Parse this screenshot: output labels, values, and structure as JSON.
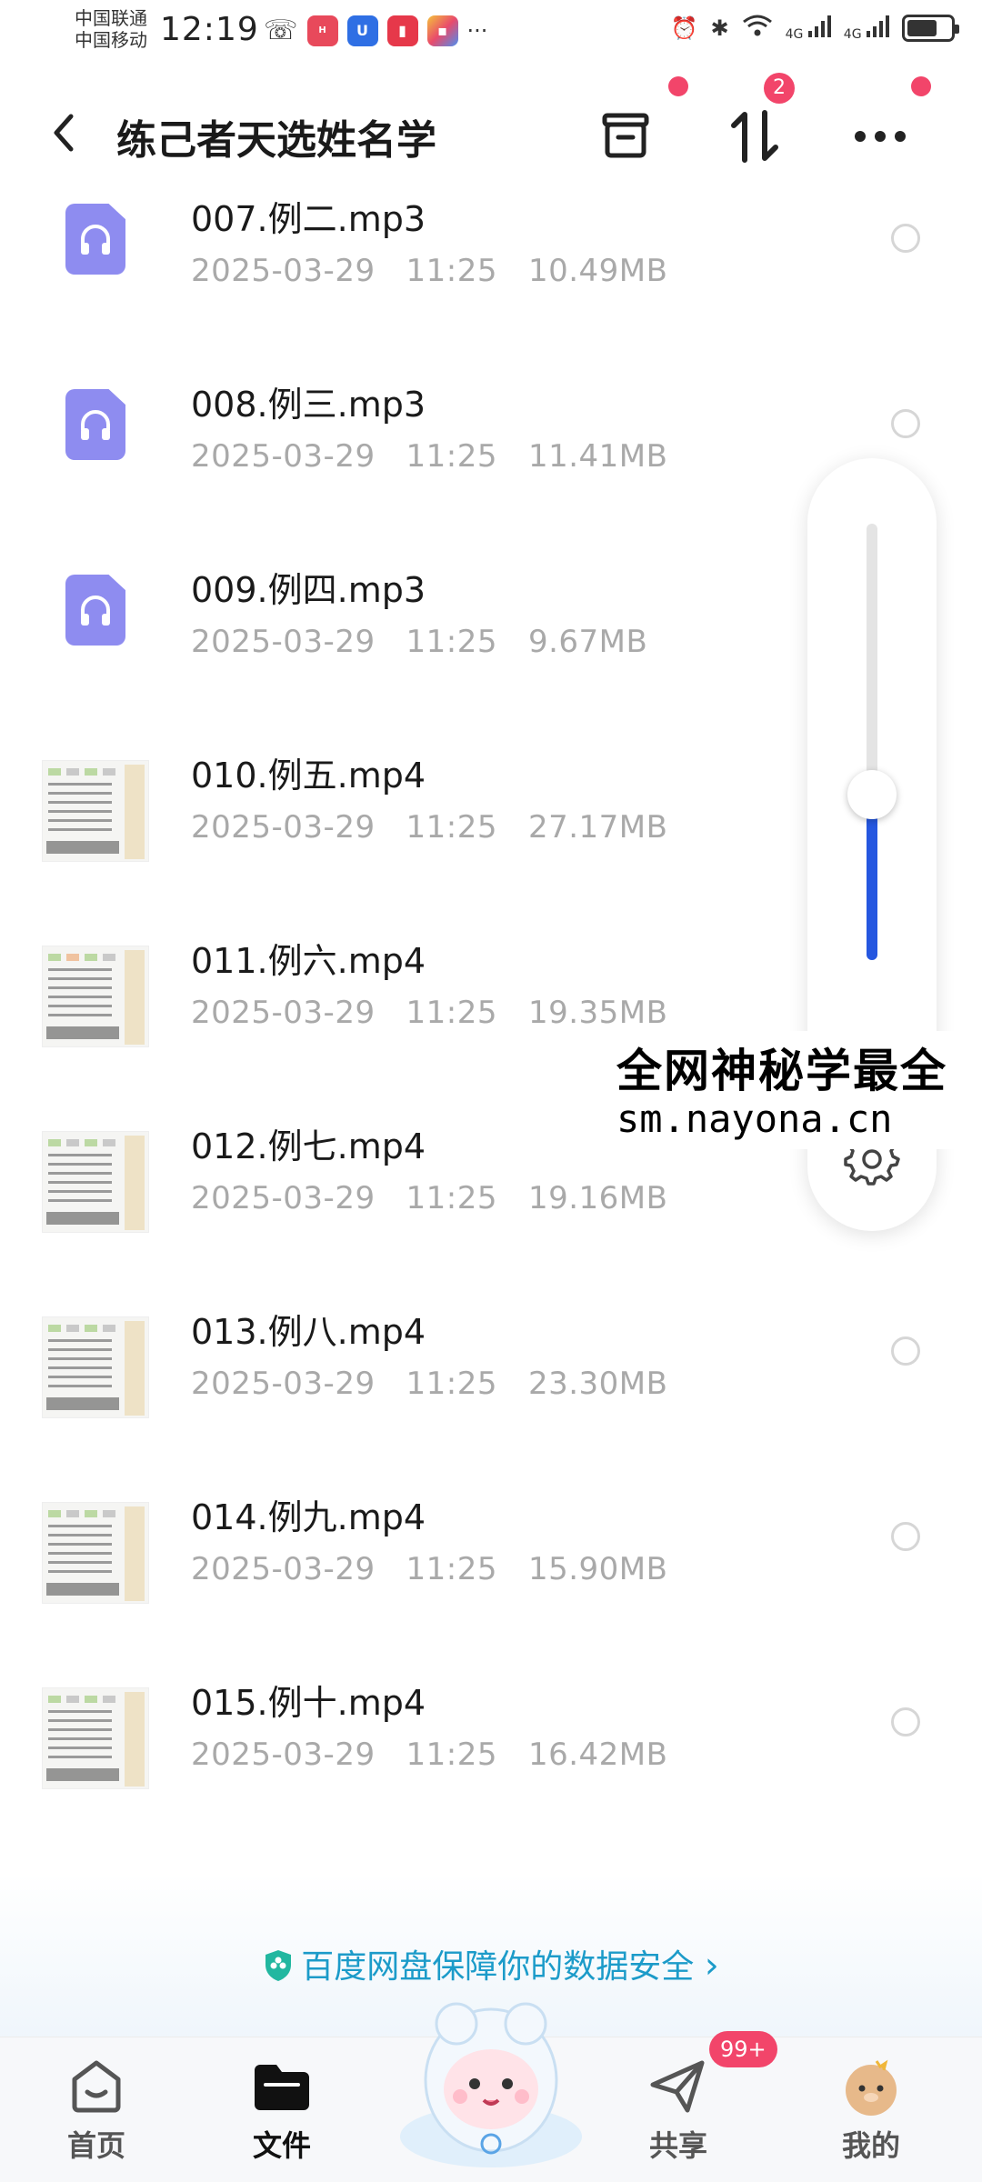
{
  "status_bar": {
    "carrier1": "中国联通",
    "carrier2": "中国移动",
    "time": "12:19",
    "signal1": "4G",
    "signal2": "4G"
  },
  "header": {
    "title": "练己者天选姓名学",
    "transfer_badge": "2"
  },
  "files": [
    {
      "name": "007.例二.mp3",
      "date": "2025-03-29",
      "time": "11:25",
      "size": "10.49MB",
      "type": "audio"
    },
    {
      "name": "008.例三.mp3",
      "date": "2025-03-29",
      "time": "11:25",
      "size": "11.41MB",
      "type": "audio"
    },
    {
      "name": "009.例四.mp3",
      "date": "2025-03-29",
      "time": "11:25",
      "size": "9.67MB",
      "type": "audio"
    },
    {
      "name": "010.例五.mp4",
      "date": "2025-03-29",
      "time": "11:25",
      "size": "27.17MB",
      "type": "video"
    },
    {
      "name": "011.例六.mp4",
      "date": "2025-03-29",
      "time": "11:25",
      "size": "19.35MB",
      "type": "video"
    },
    {
      "name": "012.例七.mp4",
      "date": "2025-03-29",
      "time": "11:25",
      "size": "19.16MB",
      "type": "video"
    },
    {
      "name": "013.例八.mp4",
      "date": "2025-03-29",
      "time": "11:25",
      "size": "23.30MB",
      "type": "video"
    },
    {
      "name": "014.例九.mp4",
      "date": "2025-03-29",
      "time": "11:25",
      "size": "15.90MB",
      "type": "video"
    },
    {
      "name": "015.例十.mp4",
      "date": "2025-03-29",
      "time": "11:25",
      "size": "16.42MB",
      "type": "video"
    }
  ],
  "volume": {
    "level": 0.38
  },
  "watermark": {
    "line1": "全网神秘学最全",
    "line2": "sm.nayona.cn"
  },
  "banner": {
    "text": "百度网盘保障你的数据安全",
    "chevron": "›"
  },
  "nav": {
    "home": "首页",
    "files": "文件",
    "share": "共享",
    "mine": "我的",
    "share_badge": "99+"
  },
  "colors": {
    "accent": "#2557e0",
    "badge": "#f2456a",
    "banner_text": "#1c9bc9",
    "audio_icon": "#8e8cf0"
  }
}
